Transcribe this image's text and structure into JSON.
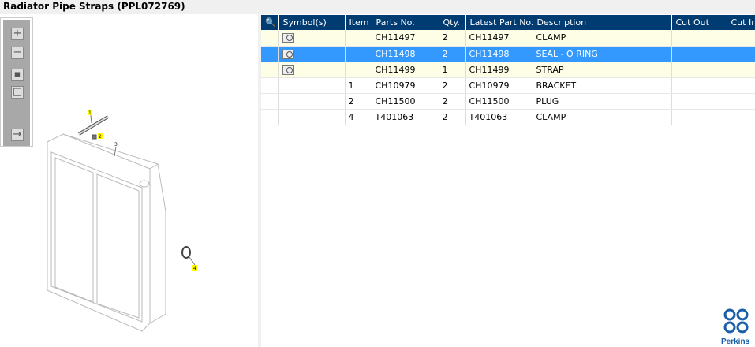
{
  "title": "Radiator Pipe Straps (PPL072769)",
  "toolbar": {
    "zoom_in": "zoom-in",
    "zoom_out": "zoom-out",
    "fit": "fit-all",
    "actual": "actual-size",
    "export": "export"
  },
  "drawing": {
    "callouts": [
      "1",
      "2",
      "3",
      "4"
    ]
  },
  "table": {
    "headers": [
      "",
      "Symbol(s)",
      "Item",
      "Parts No.",
      "Qty.",
      "Latest Part No.",
      "Description",
      "Cut Out",
      "Cut In"
    ],
    "rows": [
      {
        "symbol": true,
        "item": "",
        "part": "CH11497",
        "qty": "2",
        "latest": "CH11497",
        "desc": "CLAMP",
        "style": "y"
      },
      {
        "symbol": true,
        "item": "",
        "part": "CH11498",
        "qty": "2",
        "latest": "CH11498",
        "desc": "SEAL - O RING",
        "style": "sel"
      },
      {
        "symbol": true,
        "item": "",
        "part": "CH11499",
        "qty": "1",
        "latest": "CH11499",
        "desc": "STRAP",
        "style": "y"
      },
      {
        "symbol": false,
        "item": "1",
        "part": "CH10979",
        "qty": "2",
        "latest": "CH10979",
        "desc": "BRACKET",
        "style": ""
      },
      {
        "symbol": false,
        "item": "2",
        "part": "CH11500",
        "qty": "2",
        "latest": "CH11500",
        "desc": "PLUG",
        "style": ""
      },
      {
        "symbol": false,
        "item": "4",
        "part": "T401063",
        "qty": "2",
        "latest": "T401063",
        "desc": "CLAMP",
        "style": ""
      }
    ]
  },
  "logo": "Perkins",
  "colors": {
    "header": "#003b71",
    "selected": "#3399ff",
    "highlight": "#fefee6"
  }
}
